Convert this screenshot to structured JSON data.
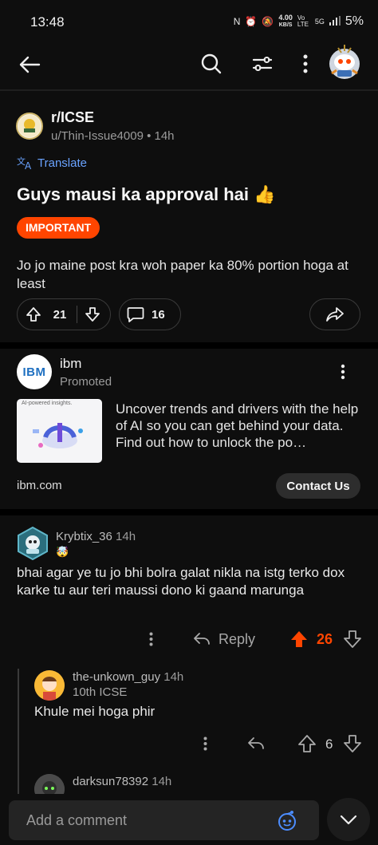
{
  "status": {
    "time": "13:48",
    "net_speed": "4.00",
    "net_unit": "KB/S",
    "volte": "Vo LTE",
    "network": "5G",
    "battery": "5%"
  },
  "post": {
    "subreddit": "r/ICSE",
    "author": "u/Thin-Issue4009",
    "time": "14h",
    "translate_label": "Translate",
    "title": "Guys mausi ka approval hai 👍",
    "flair": "IMPORTANT",
    "body": "Jo jo maine post kra woh paper ka 80% portion hoga at least",
    "upvotes": "21",
    "comments": "16"
  },
  "ad": {
    "logo_text": "IBM",
    "name": "ibm",
    "promoted": "Promoted",
    "image_caption": "AI-powered insights.",
    "text": "Uncover trends and drivers with the help of AI so you can get behind your data. Find out how to unlock the po…",
    "domain": "ibm.com",
    "cta": "Contact Us"
  },
  "comments": [
    {
      "user": "Krybtix_36",
      "time": "14h",
      "flair": "🤯",
      "body": "bhai agar ye tu jo bhi bolra galat nikla na istg terko dox karke tu aur teri maussi dono ki gaand marunga",
      "reply_label": "Reply",
      "score": "26"
    },
    {
      "user": "the-unkown_guy",
      "time": "14h",
      "flair": "10th ICSE",
      "body": "Khule mei hoga phir",
      "score": "6"
    },
    {
      "user": "darksun78392",
      "time": "14h"
    }
  ],
  "composer": {
    "placeholder": "Add a comment"
  },
  "colors": {
    "accent": "#ff4500",
    "link": "#6aa3ff",
    "background": "#0e0e0e"
  }
}
